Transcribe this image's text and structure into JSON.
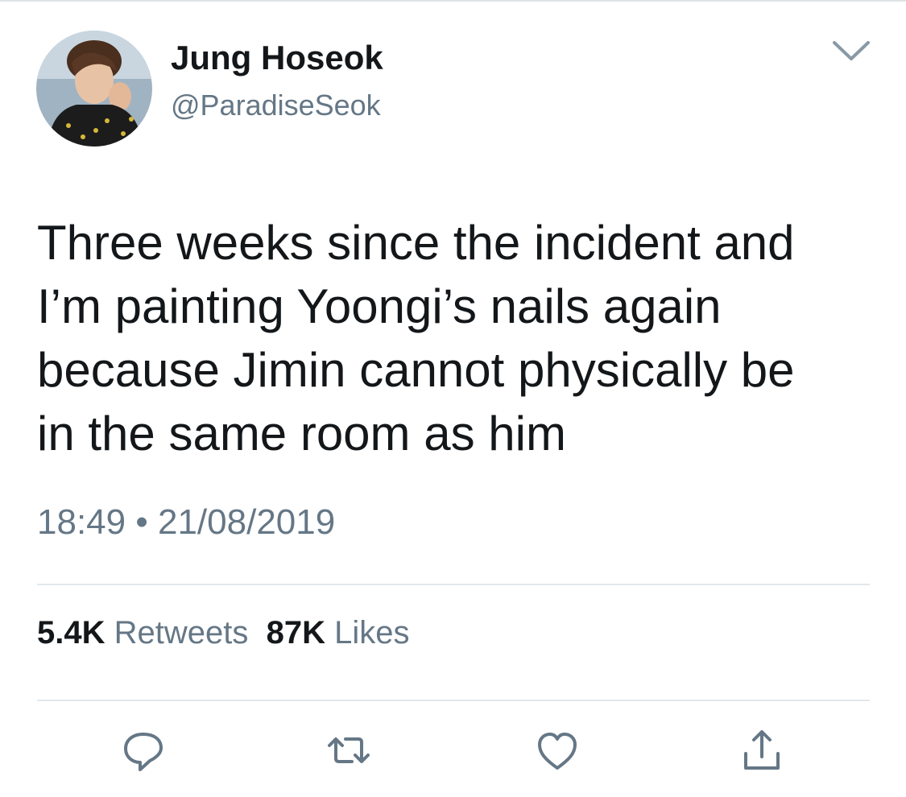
{
  "tweet": {
    "author_name": "Jung Hoseok",
    "author_handle": "@ParadiseSeok",
    "text": "Three weeks since the incident and\nI’m painting Yoongi’s nails again\nbecause Jimin cannot physically be\nin the same room as him",
    "time": "18:49",
    "separator": "•",
    "date": "21/08/2019"
  },
  "stats": {
    "retweets_count": "5.4K",
    "retweets_label": "Retweets",
    "likes_count": "87K",
    "likes_label": "Likes"
  },
  "icons": {
    "menu": "chevron-down-icon",
    "reply": "reply-icon",
    "retweet": "retweet-icon",
    "like": "heart-icon",
    "share": "share-icon"
  },
  "colors": {
    "primary_text": "#14171a",
    "secondary_text": "#657786",
    "divider": "#e1e8ed"
  }
}
